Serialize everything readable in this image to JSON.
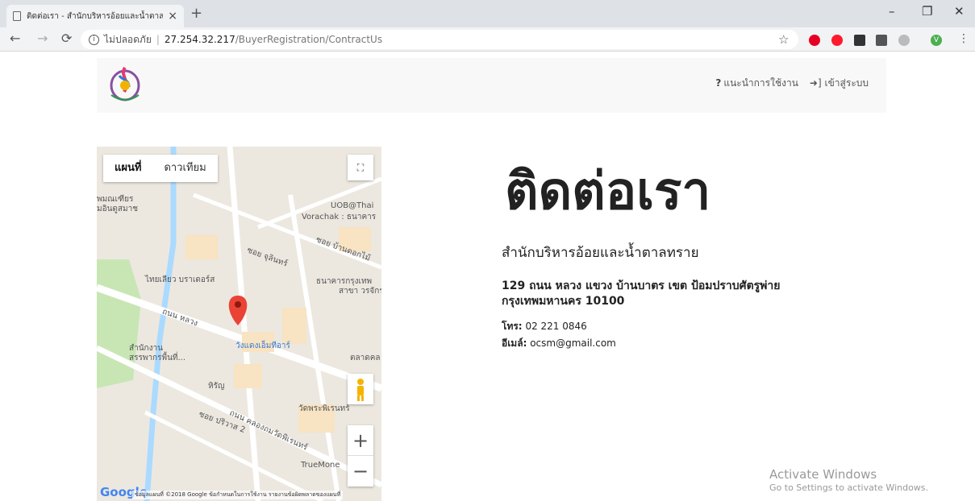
{
  "browser": {
    "tab_title": "ติดต่อเรา - สำนักบริหารอ้อยและน้ำตาล",
    "tab_close": "×",
    "new_tab": "+",
    "security_label": "ไม่ปลอดภัย",
    "url_host": "27.254.32.217",
    "url_path": "/BuyerRegistration/ContractUs",
    "window_controls": [
      "–",
      "❐",
      "✕"
    ],
    "ext_colors": [
      "#e60023",
      "#ff1b2d",
      "#333333",
      "#555555",
      "#bbbbbb",
      "#4caf50"
    ],
    "profile_initial": "V"
  },
  "header": {
    "logo_icon": "org-logo-icon",
    "nav": {
      "guide_icon": "?",
      "guide_label": "แนะนำการใช้งาน",
      "login_icon": "sign-in-icon",
      "login_label": "เข้าสู่ระบบ"
    }
  },
  "map": {
    "type_map": "แผนที่",
    "type_satellite": "ดาวเทียม",
    "zoom_in": "+",
    "zoom_out": "−",
    "labels": [
      "ไทยเลียว บราเดอร์ส",
      "UOB@Thai",
      "Vorachak : ธนาคาร",
      "ซอย จุลินทร์",
      "ซอย บ้านดอกไม้",
      "ธนาคารกรุงเทพ",
      "สาขา วรจักร",
      "ถนน หลวง",
      "วังแดงเอ็มทีอาร์",
      "สำนักงาน",
      "สรรพากรพื้นที่...",
      "ตลาดคล",
      "หิรัญ",
      "วัดพระพิเรนทร์",
      "ซอย ปริวาส 2",
      "ถนน คลองถมวัดพิเรนทร์",
      "TrueMone",
      "พมณเฑียร",
      "มอินดูสมาช"
    ],
    "brand": "Google",
    "footer": "ข้อมูลแผนที่ ©2018 Google   ข้อกำหนดในการใช้งาน   รายงานข้อผิดพลาดของแผนที่"
  },
  "contact": {
    "title": "ติดต่อเรา",
    "org_name": "สำนักบริหารอ้อยและน้ำตาลทราย",
    "address_line1": "129 ถนน หลวง แขวง บ้านบาตร เขต ป้อมปราบศัตรูพ่าย",
    "address_line2": "กรุงเทพมหานคร 10100",
    "phone_label": "โทร:",
    "phone": "02 221 0846",
    "email_label": "อีเมล์:",
    "email": "ocsm@gmail.com"
  },
  "watermark": {
    "line1": "Activate Windows",
    "line2": "Go to Settings to activate Windows."
  }
}
